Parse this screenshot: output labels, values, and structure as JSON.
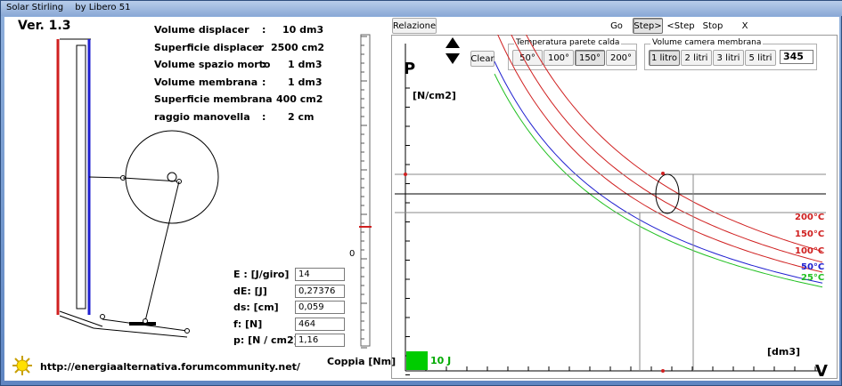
{
  "window": {
    "title": "Solar Stirling",
    "author": "by Libero 51"
  },
  "version": "Ver. 1.3",
  "params": [
    {
      "label": "Volume displacer",
      "sep": ":",
      "value": "10 dm3"
    },
    {
      "label": "Superficie displacer",
      "sep": ":",
      "value": "2500  cm2"
    },
    {
      "label": "Volume spazio morto",
      "sep": ":",
      "value": "1 dm3"
    },
    {
      "label": "Volume membrana",
      "sep": ":",
      "value": "1 dm3"
    },
    {
      "label": "Superficie membrana",
      "sep": ":",
      "value": "400 cm2"
    },
    {
      "label": "raggio manovella",
      "sep": ":",
      "value": "2 cm"
    }
  ],
  "readouts": [
    {
      "label": "E :  [J/giro]",
      "value": "14"
    },
    {
      "label": "dE:  [J]",
      "value": "0,27376"
    },
    {
      "label": "ds:  [cm]",
      "value": "0,059"
    },
    {
      "label": "f:    [N]",
      "value": "464"
    },
    {
      "label": "p:   [N / cm2]",
      "value": "1,16"
    }
  ],
  "gauge": {
    "zero_label": "0",
    "axis_label": "Coppia [Nm]"
  },
  "url": "http://energiaalternativa.forumcommunity.net/",
  "toolbar": {
    "relazione": "Relazione",
    "go": "Go",
    "step_fwd": "Step>",
    "step_back": "<Step",
    "stop": "Stop",
    "close": "X",
    "clear": "Clear"
  },
  "temperatura": {
    "title": "Temperatura parete calda",
    "options": [
      "50°",
      "100°",
      "150°",
      "200°"
    ],
    "selected": "150°"
  },
  "volume": {
    "title": "Volume camera membrana",
    "options": [
      "1 litro",
      "2 litri",
      "3 litri",
      "5 litri"
    ],
    "selected": "1 litro",
    "value": "345"
  },
  "chart_data": {
    "type": "line",
    "ylabel_letter": "P",
    "ylabel_unit": "[N/cm2]",
    "xlabel_letter": "V",
    "xlabel_unit": "[dm3]",
    "energy_label": "10 J",
    "series": [
      {
        "name": "200°C",
        "color": "#d02020",
        "k": 1.36
      },
      {
        "name": "150°C",
        "color": "#d02020",
        "k": 1.25
      },
      {
        "name": "100°C",
        "color": "#d02020",
        "k": 1.15
      },
      {
        "name": "50°C",
        "color": "#2020d0",
        "k": 1.04
      },
      {
        "name": "25°C",
        "color": "#20c020",
        "k": 1.0
      }
    ],
    "colors": {
      "hot": "#d02020",
      "cold": "#2020d0",
      "ambient": "#20c020",
      "energy": "#00cc00"
    }
  }
}
